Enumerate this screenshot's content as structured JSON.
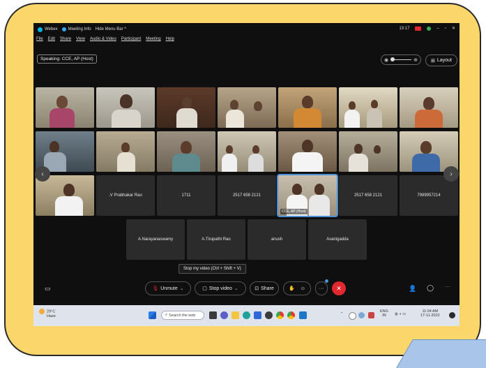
{
  "titlebar": {
    "app": "Webex",
    "meeting_info": "Meeting Info",
    "hide_menu": "Hide Menu Bar ^",
    "time": "13:17"
  },
  "menu": [
    "File",
    "Edit",
    "Share",
    "View",
    "Audio & Video",
    "Participant",
    "Meeting",
    "Help"
  ],
  "speaking": "Speaking: CCE, AP (Host)",
  "layout_label": "Layout",
  "tiles_names": [
    {
      "label": ".V Prabhakar Rao"
    },
    {
      "label": "1711"
    },
    {
      "label": "2517 658 2121"
    },
    {
      "label": "2517 658 2121"
    },
    {
      "label": "7989957214"
    }
  ],
  "active_tile_label": "CCE, AP (Host)",
  "bottom_row": [
    "A.Narayanaswamy",
    "A.Tirupathi Rao",
    "anush",
    "Avanigadda"
  ],
  "tooltip": "Stop my video (Ctrl + Shift + V)",
  "controls": {
    "unmute": "Unmute",
    "stop_video": "Stop video",
    "share": "Share"
  },
  "taskbar": {
    "weather_temp": "29°C",
    "weather_desc": "Haze",
    "search_placeholder": "Search the web",
    "lang_top": "ENG",
    "lang_bottom": "IN",
    "clock_time": "11:04 AM",
    "clock_date": "17-11-2022"
  },
  "colors": {
    "accent": "#4a90d9",
    "end_call": "#e1282e",
    "frame": "#fbd66b"
  }
}
